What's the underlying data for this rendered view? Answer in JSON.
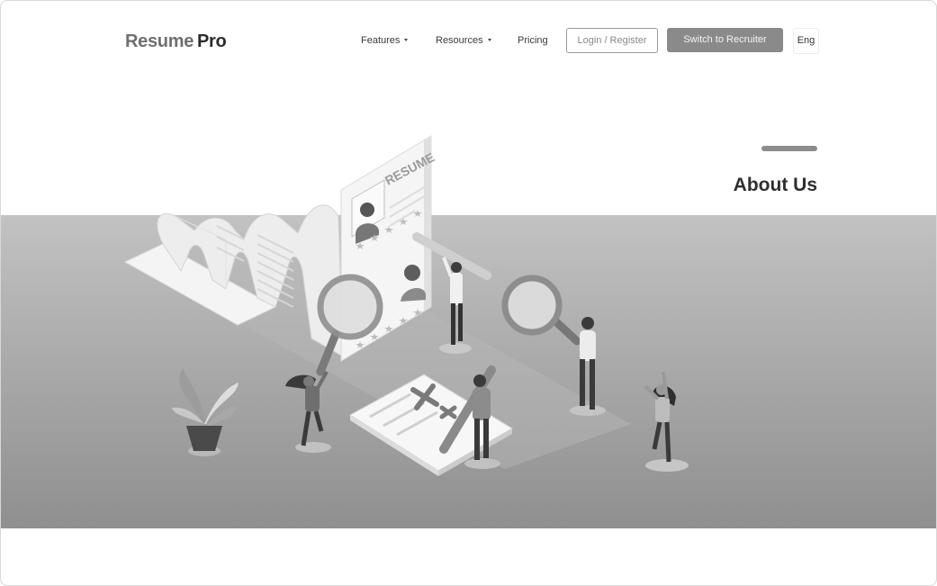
{
  "header": {
    "logo": {
      "part1": "Resume",
      "part2": "Pro"
    },
    "nav": {
      "features": "Features",
      "resources": "Resources",
      "pricing": "Pricing"
    },
    "login_register": "Login / Register",
    "switch_to_recruiter": "Switch to Recruiter",
    "language": "Eng"
  },
  "hero": {
    "title": "About Us",
    "illustration": {
      "resume_card_label": "RESUME",
      "figures": [
        "paper-scroll",
        "resume-card",
        "magnifier",
        "magnifier",
        "clipboard",
        "plant",
        "people"
      ]
    }
  },
  "icons": [
    "chevron-down-icon",
    "chevron-down-icon",
    "magnifier-icon",
    "star-icon",
    "check-icon",
    "x-icon",
    "plant-icon"
  ],
  "colors": {
    "logo_light": "#6f6f6f",
    "logo_dark": "#2c2c2c",
    "button_primary": "#8a8a8a",
    "accent_bar": "#8c8c8c",
    "hero_band": "#a6a6a6"
  }
}
